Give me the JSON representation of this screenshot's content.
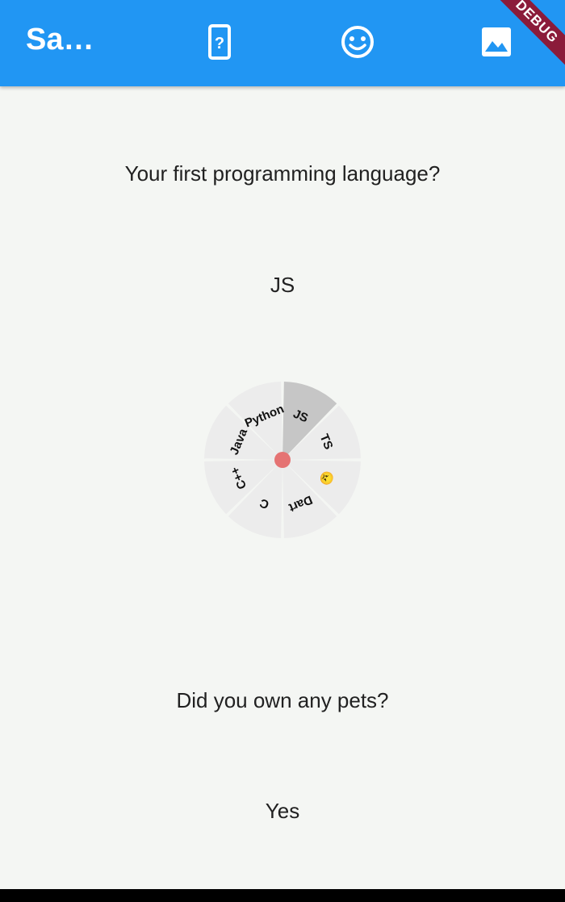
{
  "app_bar": {
    "title": "Sam…",
    "icons": [
      "help-phone-icon",
      "smiley-face-icon",
      "image-icon"
    ],
    "debug_banner": "DEBUG"
  },
  "survey": {
    "question1": "Your first programming language?",
    "answer1": "JS",
    "question2": "Did you own any pets?",
    "answer2": "Yes"
  },
  "wheel": {
    "segments": [
      "JS",
      "TS",
      "😠",
      "Dart",
      "C",
      "C++",
      "Java",
      "Python"
    ],
    "selected": "JS",
    "colors": {
      "selected": "#c6c6c6",
      "normal": "#ececec",
      "center": "#e57373"
    }
  }
}
